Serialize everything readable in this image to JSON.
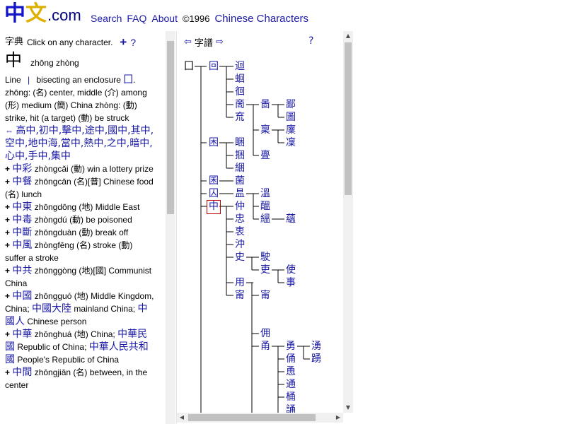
{
  "header": {
    "logo_char1": "中",
    "logo_char2": "文",
    "logo_domain": ".com",
    "nav": [
      "Search",
      "FAQ",
      "About"
    ],
    "copyright": "©1996",
    "site_title": "Chinese Characters"
  },
  "dictionary": {
    "label": "字典",
    "instruction": "Click on any character.",
    "plus": "+",
    "help": "?",
    "char": "中",
    "pinyin": "zhōng zhòng",
    "line_desc_a": "Line",
    "line_sym": "|",
    "line_desc_b": "bisecting an enclosure",
    "enclosure_char": "囗",
    "period": ".",
    "def1": "zhōng: (名) center, middle (介) among",
    "def2": "(形) medium (簡) China zhòng: (動)",
    "def3": "strike, hit (a target) (動) be struck",
    "compounds_arrow": "⇔",
    "compounds": "高中,初中,擊中,途中,國中,其中,空中,地中海,當中,熱中,之中,暗中,心中,手中,集中",
    "entries": [
      {
        "zh": "中彩",
        "text": "zhòngcǎi (動) win a lottery prize"
      },
      {
        "zh": "中餐",
        "text": "zhōngcān (名)[普] Chinese food (名) lunch"
      },
      {
        "zh": "中東",
        "text": "zhōngdōng (地) Middle East"
      },
      {
        "zh": "中毒",
        "text": "zhòngdú (動) be poisoned"
      },
      {
        "zh": "中斷",
        "text": "zhōngduàn (動) break off"
      },
      {
        "zh": "中風",
        "text": "zhòngfēng (名) stroke (動) suffer a stroke"
      },
      {
        "zh": "中共",
        "text": "zhōnggòng (地)[國] Communist China"
      },
      {
        "zh": "中國",
        "text": "zhōngguó (地) Middle Kingdom, China;",
        "zh2": "中國大陸",
        "text2": "mainland China;",
        "zh3": "中國人",
        "text3": "Chinese person"
      },
      {
        "zh": "中華",
        "text": "zhōnghuá (地) China;",
        "zh2": "中華民國",
        "text2": "Republic of China;",
        "zh3": "中華人民共和國",
        "text3": "People's Republic of China"
      },
      {
        "zh": "中間",
        "text": "zhōngjiān (名) between, in the center"
      }
    ]
  },
  "tree": {
    "left_arrow": "⇦",
    "label": "字譜",
    "right_arrow": "⇨",
    "help": "?",
    "nodes": {
      "root": "囗",
      "hui": "回",
      "jiong": "迴",
      "hui2": "蛔",
      "hui3": "徊",
      "shang": "啇",
      "bi": "㐭",
      "bi2": "啚",
      "bi3": "鄙",
      "tu": "圖",
      "bing": "稟",
      "lin": "廩",
      "lin2": "凜",
      "fu": "㐬",
      "dan": "亶",
      "zhen": "亹",
      "kun": "困",
      "kun2": "睏",
      "kun3": "捆",
      "kun4": "綑",
      "jun": "囷",
      "jun2": "菌",
      "qiu": "囚",
      "wen": "昷",
      "wen2": "溫",
      "yun": "醞",
      "yun2": "縕",
      "yun3": "蘊",
      "zhong": "中",
      "zhong2": "仲",
      "zhong3": "忠",
      "zhong4": "衷",
      "chong": "沖",
      "shi": "史",
      "shi2": "駛",
      "li": "吏",
      "shi3": "使",
      "shi4": "事",
      "yong": "用",
      "nang": "甯",
      "ning": "甯",
      "yong2": "佣",
      "yong3": "甬",
      "yong4": "勇",
      "yong5": "湧",
      "yong6": "踴",
      "yong7": "俑",
      "yong8": "恿",
      "tong": "通",
      "tong2": "桶",
      "song": "誦"
    }
  }
}
